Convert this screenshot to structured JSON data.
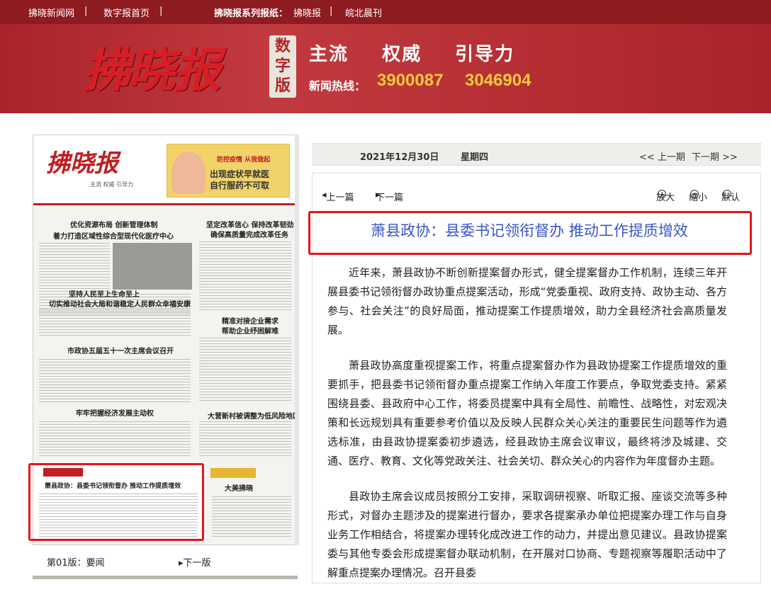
{
  "topbar": {
    "site_link": "拂晓新闻网",
    "sep": "|",
    "home_link": "数字报首页",
    "series_label": "拂晓报系列报纸：",
    "paper1": "拂晓报",
    "paper2": "皖北晨刊"
  },
  "banner": {
    "logo": "拂晓报",
    "digital_badge": "数字版",
    "slogan": [
      "主流",
      "权威",
      "引导力"
    ],
    "hotline_label": "新闻热线：",
    "hotline_numbers": [
      "3900087",
      "3046904"
    ]
  },
  "paper_page": {
    "logo": "拂晓报",
    "logo_sub": "主流 权威 引导力",
    "ad_top": "防控疫情 从我做起",
    "ad_line1": "出现症状早就医",
    "ad_line2": "自行服药不可取",
    "headlines": [
      "优化资源布局 创新管理体制",
      "着力打造区域性综合型现代化医疗中心",
      "坚持人民至上生命至上",
      "切实推动社会大局和谐稳定人民群众幸福安康",
      "坚定改革信心 保持改革韧劲",
      "确保高质量完成改革任务",
      "精准对接企业需求",
      "帮助企业纾困解难",
      "市政协五届五十一次主席会议召开",
      "牢牢把握经济发展主动权",
      "大营新村被调整为低风险地区",
      "萧县政协：县委书记领衔督办 推动工作提质增效",
      "大美拂晓"
    ]
  },
  "page_nav": {
    "label": "第01版：要闻",
    "next_page": "下一版"
  },
  "datebar": {
    "date": "2021年12月30日",
    "weekday": "星期四",
    "prev_issue": "<< 上一期",
    "next_issue": "下一期 >>"
  },
  "toolbar": {
    "prev_article": "上一篇",
    "next_article": "下一篇",
    "zoom_in": "放大",
    "zoom_out": "缩小",
    "default": "默认"
  },
  "article": {
    "title": "萧县政协：县委书记领衔督办 推动工作提质增效",
    "paragraphs": [
      "近年来，萧县政协不断创新提案督办形式，健全提案督办工作机制，连续三年开展县委书记领衔督办政协重点提案活动，形成“党委重视、政府支持、政协主动、各方参与、社会关注”的良好局面，推动提案工作提质增效，助力全县经济社会高质量发展。",
      "萧县政协高度重视提案工作，将重点提案督办作为县政协提案工作提质增效的重要抓手，把县委书记领衔督办重点提案工作纳入年度工作要点，争取党委支持。紧紧围绕县委、县政府中心工作，将委员提案中具有全局性、前瞻性、战略性，对宏观决策和长远规划具有重要参考价值以及反映人民群众关心关注的重要民生问题等作为遴选标准，由县政协提案委初步遴选，经县政协主席会议审议，最终将涉及城建、交通、医疗、教育、文化等党政关注、社会关切、群众关心的内容作为年度督办主题。",
      "县政协主席会议成员按照分工安排，采取调研视察、听取汇报、座谈交流等多种形式，对督办主题涉及的提案进行督办，要求各提案承办单位把提案办理工作与自身业务工作相结合，将提案办理转化成改进工作的动力，并提出意见建议。县政协提案委与其他专委会形成提案督办联动机制，在开展对口协商、专题视察等履职活动中了解重点提案办理情况。召开县委"
    ]
  }
}
